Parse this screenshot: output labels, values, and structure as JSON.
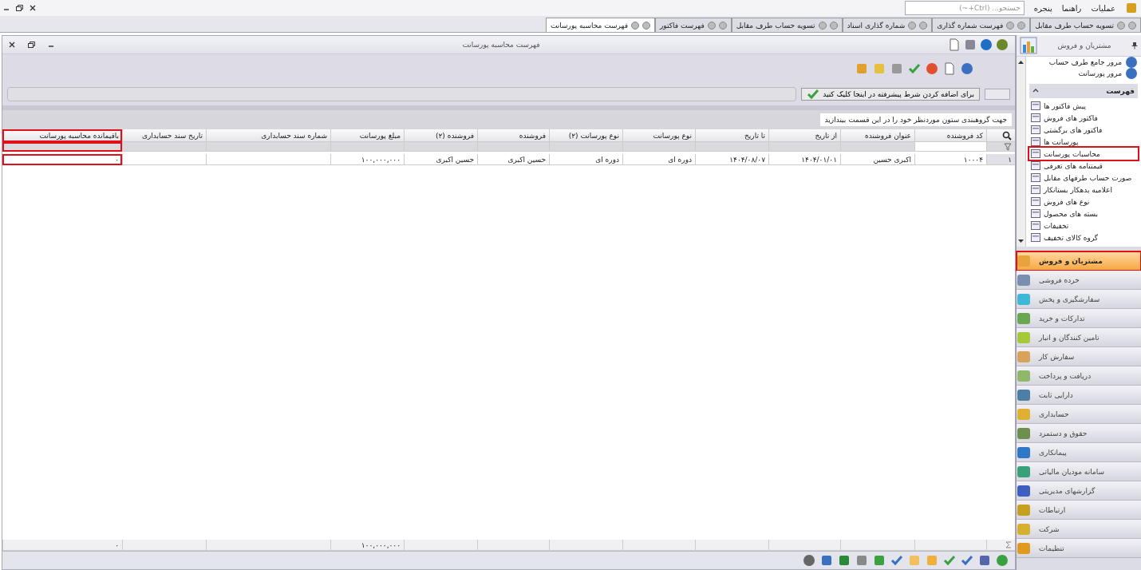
{
  "menu": [
    "عملیات",
    "راهنما",
    "پنجره"
  ],
  "search": {
    "placeholder": "جستجو... (Ctrl+~)"
  },
  "tabs": [
    {
      "label": "تسویه حساب طرف مقابل",
      "selected": false
    },
    {
      "label": "فهرست شماره گذاری",
      "selected": false
    },
    {
      "label": "شماره گذاری اسناد",
      "selected": false
    },
    {
      "label": "تسویه حساب طرف مقابل",
      "selected": false
    },
    {
      "label": "فهرست فاکتور",
      "selected": false
    },
    {
      "label": "فهرست محاسبه پورسانت",
      "selected": true
    }
  ],
  "window": {
    "title": "فهرست محاسبه پورسانت"
  },
  "filter_button": "برای اضافه کردن شرط پیشرفته در اینجا کلیک کنید",
  "group_panel": "جهت گروهبندی ستون موردنظر خود را در این قسمت بیندازید",
  "table": {
    "row_number": "۱",
    "columns": [
      {
        "label": "کد فروشنده",
        "highlighted": false,
        "value": "۱۰۰۰۴"
      },
      {
        "label": "عنوان فروشنده",
        "highlighted": false,
        "value": "اکبری حسین"
      },
      {
        "label": "از تاریخ",
        "highlighted": false,
        "value": "۱۴۰۴/۰۱/۰۱"
      },
      {
        "label": "تا تاریخ",
        "highlighted": false,
        "value": "۱۴۰۴/۰۸/۰۷"
      },
      {
        "label": "نوع پورسانت",
        "highlighted": false,
        "value": "دوره ای"
      },
      {
        "label": "نوع پورسانت (۲)",
        "highlighted": false,
        "value": "دوره ای"
      },
      {
        "label": "فروشنده",
        "highlighted": false,
        "value": "حسین اکبری"
      },
      {
        "label": "فروشنده (۲)",
        "highlighted": false,
        "value": "حسین اکبری"
      },
      {
        "label": "مبلغ پورسانت",
        "highlighted": false,
        "value": "۱۰۰,۰۰۰,۰۰۰",
        "total": "۱۰۰,۰۰۰,۰۰۰"
      },
      {
        "label": "شماره سند حسابداری",
        "highlighted": false
      },
      {
        "label": "تاریخ سند حسابداری",
        "highlighted": false
      },
      {
        "label": "باقیمانده محاسبه پورسانت",
        "highlighted": true,
        "value": "۰",
        "total": "۰"
      }
    ]
  },
  "sidebar": {
    "title": "مشتریان و فروش",
    "links": [
      "مرور جامع طرف حساب",
      "مرور پورسانت"
    ],
    "section": {
      "title": "فهرست",
      "expanded": true,
      "items": [
        {
          "label": "پیش فاکتور ها",
          "highlighted": false
        },
        {
          "label": "فاکتور های فروش",
          "highlighted": false
        },
        {
          "label": "فاکتور های برگشتی",
          "highlighted": false
        },
        {
          "label": "پورسانت ها",
          "highlighted": false
        },
        {
          "label": "محاسبات پورسانت",
          "highlighted": true
        },
        {
          "label": "قیمتنامه های تعرفی",
          "highlighted": false
        },
        {
          "label": "صورت حساب طرفهای مقابل",
          "highlighted": false
        },
        {
          "label": "اعلامیه بدهکار بستانکار",
          "highlighted": false
        },
        {
          "label": "نوع های فروش",
          "highlighted": false
        },
        {
          "label": "بسته های محصول",
          "highlighted": false
        },
        {
          "label": "تخفیفات",
          "highlighted": false
        },
        {
          "label": "گروه کالای تخفیف",
          "highlighted": false
        }
      ]
    }
  },
  "modules": [
    {
      "label": "مشتریان و فروش",
      "selected": true,
      "highlighted": true,
      "color": "#e8a33c"
    },
    {
      "label": "خرده فروشی",
      "selected": false,
      "highlighted": false,
      "color": "#7a8fb0"
    },
    {
      "label": "سفارشگیری و پخش",
      "selected": false,
      "highlighted": false,
      "color": "#3fb8d8"
    },
    {
      "label": "تدارکات و خرید",
      "selected": false,
      "highlighted": false,
      "color": "#6aa84f"
    },
    {
      "label": "تامین کنندگان و انبار",
      "selected": false,
      "highlighted": false,
      "color": "#a6c93a"
    },
    {
      "label": "سفارش کار",
      "selected": false,
      "highlighted": false,
      "color": "#d9a25a"
    },
    {
      "label": "دریافت و پرداخت",
      "selected": false,
      "highlighted": false,
      "color": "#8fb86a"
    },
    {
      "label": "دارایی ثابت",
      "selected": false,
      "highlighted": false,
      "color": "#4d7fa6"
    },
    {
      "label": "حسابداری",
      "selected": false,
      "highlighted": false,
      "color": "#e0b030"
    },
    {
      "label": "حقوق و دستمزد",
      "selected": false,
      "highlighted": false,
      "color": "#6f8f4f"
    },
    {
      "label": "پیمانکاری",
      "selected": false,
      "highlighted": false,
      "color": "#2f78c8"
    },
    {
      "label": "سامانه مودیان مالیاتی",
      "selected": false,
      "highlighted": false,
      "color": "#3aa07a"
    },
    {
      "label": "گزارشهای مدیریتی",
      "selected": false,
      "highlighted": false,
      "color": "#3d5fc0"
    },
    {
      "label": "ارتباطات",
      "selected": false,
      "highlighted": false,
      "color": "#c8a020"
    },
    {
      "label": "شرکت",
      "selected": false,
      "highlighted": false,
      "color": "#d8b030"
    },
    {
      "label": "تنظیمات",
      "selected": false,
      "highlighted": false,
      "color": "#e09a20"
    }
  ]
}
